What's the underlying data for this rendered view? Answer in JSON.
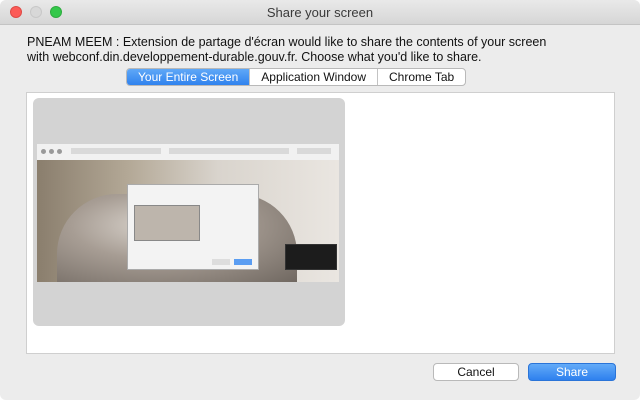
{
  "window": {
    "title": "Share your screen"
  },
  "message": {
    "line1": "PNEAM MEEM : Extension de partage d'écran would like to share the contents of your screen",
    "line2": "with webconf.din.developpement-durable.gouv.fr. Choose what you'd like to share."
  },
  "tabs": [
    {
      "label": "Your Entire Screen",
      "active": true
    },
    {
      "label": "Application Window",
      "active": false
    },
    {
      "label": "Chrome Tab",
      "active": false
    }
  ],
  "buttons": {
    "cancel": "Cancel",
    "share": "Share"
  },
  "colors": {
    "accent": "#2f82ee",
    "close": "#fc5b57",
    "maximize": "#34c84a"
  }
}
